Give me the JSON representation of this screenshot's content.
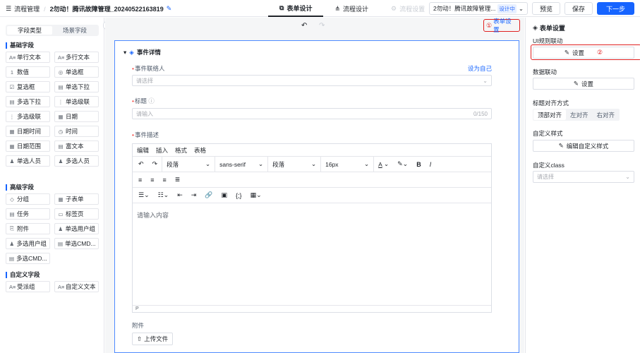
{
  "topbar": {
    "breadcrumb_root": "流程管理",
    "title": "2勿动！腾讯故障管理_20240522163819",
    "tabs": [
      {
        "label": "表单设计",
        "icon": "layers-icon"
      },
      {
        "label": "流程设计",
        "icon": "flow-icon"
      },
      {
        "label": "流程设置",
        "icon": "settings-icon"
      }
    ],
    "app_select": "2勿动！腾讯故障管理...",
    "app_badge": "设计中",
    "preview": "预览",
    "save": "保存",
    "next": "下一步"
  },
  "left": {
    "seg": [
      "字段类型",
      "场景字段"
    ],
    "groups": [
      {
        "title": "基础字段",
        "items": [
          {
            "label": "单行文本",
            "icon": "A≡"
          },
          {
            "label": "多行文本",
            "icon": "A≡"
          },
          {
            "label": "数值",
            "icon": "1"
          },
          {
            "label": "单选框",
            "icon": "◎"
          },
          {
            "label": "复选框",
            "icon": "☑"
          },
          {
            "label": "单选下拉",
            "icon": "▤"
          },
          {
            "label": "多选下拉",
            "icon": "▤"
          },
          {
            "label": "单选级联",
            "icon": "⋮"
          },
          {
            "label": "多选级联",
            "icon": "⋮"
          },
          {
            "label": "日期",
            "icon": "▦"
          },
          {
            "label": "日期时间",
            "icon": "▦"
          },
          {
            "label": "时间",
            "icon": "◷"
          },
          {
            "label": "日期范围",
            "icon": "▦"
          },
          {
            "label": "富文本",
            "icon": "▤"
          },
          {
            "label": "单选人员",
            "icon": "♟"
          },
          {
            "label": "多选人员",
            "icon": "♟"
          }
        ]
      },
      {
        "title": "高级字段",
        "items": [
          {
            "label": "分组",
            "icon": "◇"
          },
          {
            "label": "子表单",
            "icon": "▦"
          },
          {
            "label": "任务",
            "icon": "▤"
          },
          {
            "label": "标签页",
            "icon": "▭"
          },
          {
            "label": "附件",
            "icon": "⎘"
          },
          {
            "label": "单选用户组",
            "icon": "♟"
          },
          {
            "label": "多选用户组",
            "icon": "♟"
          },
          {
            "label": "单选CMD...",
            "icon": "▤"
          },
          {
            "label": "多选CMD...",
            "icon": "▤"
          }
        ]
      },
      {
        "title": "自定义字段",
        "items": [
          {
            "label": "受派组",
            "icon": "A≡"
          },
          {
            "label": "自定义文本",
            "icon": "A≡"
          }
        ]
      }
    ]
  },
  "center": {
    "form_settings_num": "①",
    "form_settings": "表单设置",
    "section_title": "事件详情",
    "contact_label": "事件联络人",
    "set_self": "设为自己",
    "contact_placeholder": "请选择",
    "title_label": "标题",
    "title_placeholder": "请输入",
    "title_counter": "0/150",
    "desc_label": "事件描述",
    "editor_menu": [
      "编辑",
      "插入",
      "格式",
      "表格"
    ],
    "dd_para1": "段落",
    "dd_font": "sans-serif",
    "dd_para2": "段落",
    "dd_size": "16px",
    "editor_placeholder": "请输入内容",
    "editor_status": "P",
    "attach_label": "附件",
    "upload": "上传文件"
  },
  "right": {
    "title": "表单设置",
    "ui_rule": "UI规则联动",
    "setting_btn": "设置",
    "num2": "②",
    "data_link": "数据联动",
    "setting_btn2": "设置",
    "align_label": "标题对齐方式",
    "align_opts": [
      "顶部对齐",
      "左对齐",
      "右对齐"
    ],
    "custom_style": "自定义样式",
    "edit_style": "编辑自定义样式",
    "custom_class": "自定义class",
    "class_placeholder": "请选择"
  }
}
